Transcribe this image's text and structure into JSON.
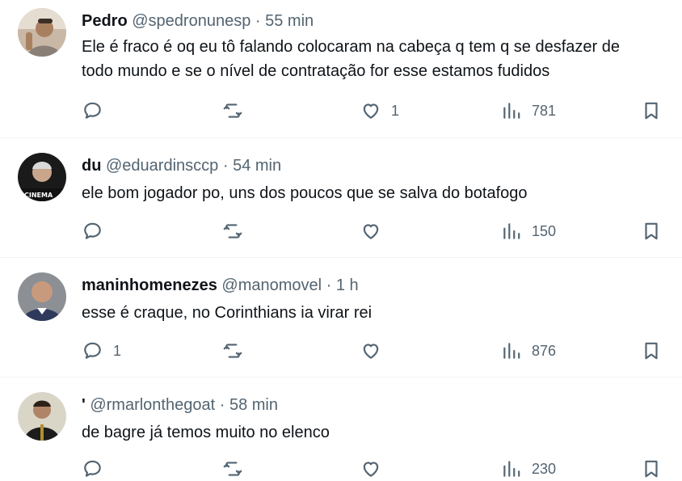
{
  "replies": [
    {
      "name": "Pedro",
      "handle": "@spedronunesp",
      "separator": "·",
      "time": "55 min",
      "text_lines": [
        "Ele é fraco é oq eu tô falando colocaram na cabeça q tem q se desfazer de",
        "todo mundo e se o nível de contratação for esse estamos fudidos"
      ],
      "reply_count": "",
      "repost_count": "",
      "like_count": "1",
      "views": "781"
    },
    {
      "name": "du",
      "handle": "@eduardinsccp",
      "separator": "·",
      "time": "54 min",
      "text_lines": [
        "ele bom jogador po, uns dos poucos que se salva do botafogo"
      ],
      "avatar_text": "CINEMA",
      "reply_count": "",
      "repost_count": "",
      "like_count": "",
      "views": "150"
    },
    {
      "name": "maninhomenezes",
      "handle": "@manomovel",
      "separator": "·",
      "time": "1 h",
      "text_lines": [
        "esse é craque, no Corinthians ia virar rei"
      ],
      "reply_count": "1",
      "repost_count": "",
      "like_count": "",
      "views": "876"
    },
    {
      "name": "'",
      "handle": "@rmarlonthegoat",
      "separator": "·",
      "time": "58 min",
      "text_lines": [
        "de bagre já temos muito no elenco"
      ],
      "reply_count": "",
      "repost_count": "",
      "like_count": "",
      "views": "230"
    }
  ],
  "icons": {
    "reply": "speech-bubble-icon",
    "repost": "repost-arrows-icon",
    "like": "heart-icon",
    "views": "bar-chart-icon",
    "bookmark": "bookmark-icon"
  },
  "colors": {
    "text_primary": "#0f1419",
    "text_secondary": "#536471",
    "divider": "#eff3f4"
  }
}
